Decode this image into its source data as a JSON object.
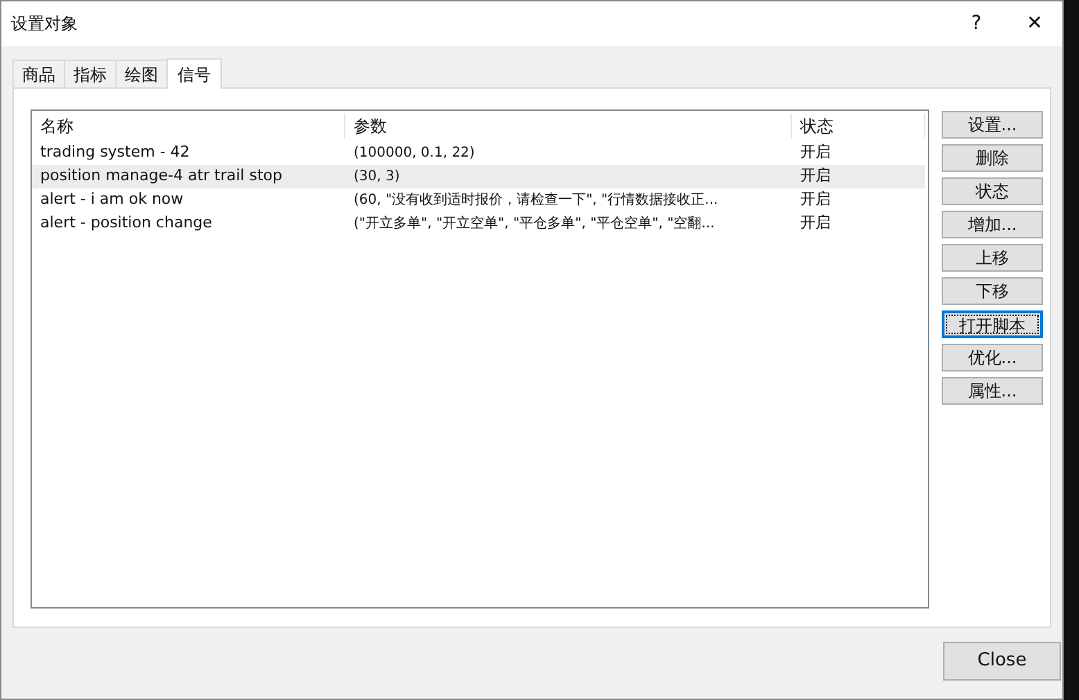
{
  "window": {
    "title": "设置对象",
    "help": "?",
    "close": "✕"
  },
  "tabs": [
    {
      "label": "商品",
      "selected": false
    },
    {
      "label": "指标",
      "selected": false
    },
    {
      "label": "绘图",
      "selected": false
    },
    {
      "label": "信号",
      "selected": true
    }
  ],
  "table": {
    "columns": [
      "名称",
      "参数",
      "状态"
    ],
    "rows": [
      {
        "cells": [
          "trading system - 42",
          "(100000, 0.1, 22)",
          "开启"
        ],
        "selected": false
      },
      {
        "cells": [
          "position manage-4 atr trail stop",
          "(30, 3)",
          "开启"
        ],
        "selected": true
      },
      {
        "cells": [
          "alert - i am ok now",
          "(60, \"没有收到适时报价，请检查一下\", \"行情数据接收正...",
          "开启"
        ],
        "selected": false
      },
      {
        "cells": [
          "alert - position change",
          "(\"开立多单\", \"开立空单\", \"平仓多单\", \"平仓空单\", \"空翻...",
          "开启"
        ],
        "selected": false
      }
    ]
  },
  "buttons": [
    {
      "label": "设置...",
      "focused": false
    },
    {
      "label": "删除",
      "focused": false
    },
    {
      "label": "状态",
      "focused": false
    },
    {
      "label": "增加...",
      "focused": false
    },
    {
      "label": "上移",
      "focused": false
    },
    {
      "label": "下移",
      "focused": false
    },
    {
      "label": "打开脚本",
      "focused": true
    },
    {
      "label": "优化...",
      "focused": false
    },
    {
      "label": "属性...",
      "focused": false
    }
  ],
  "close_button": "Close"
}
